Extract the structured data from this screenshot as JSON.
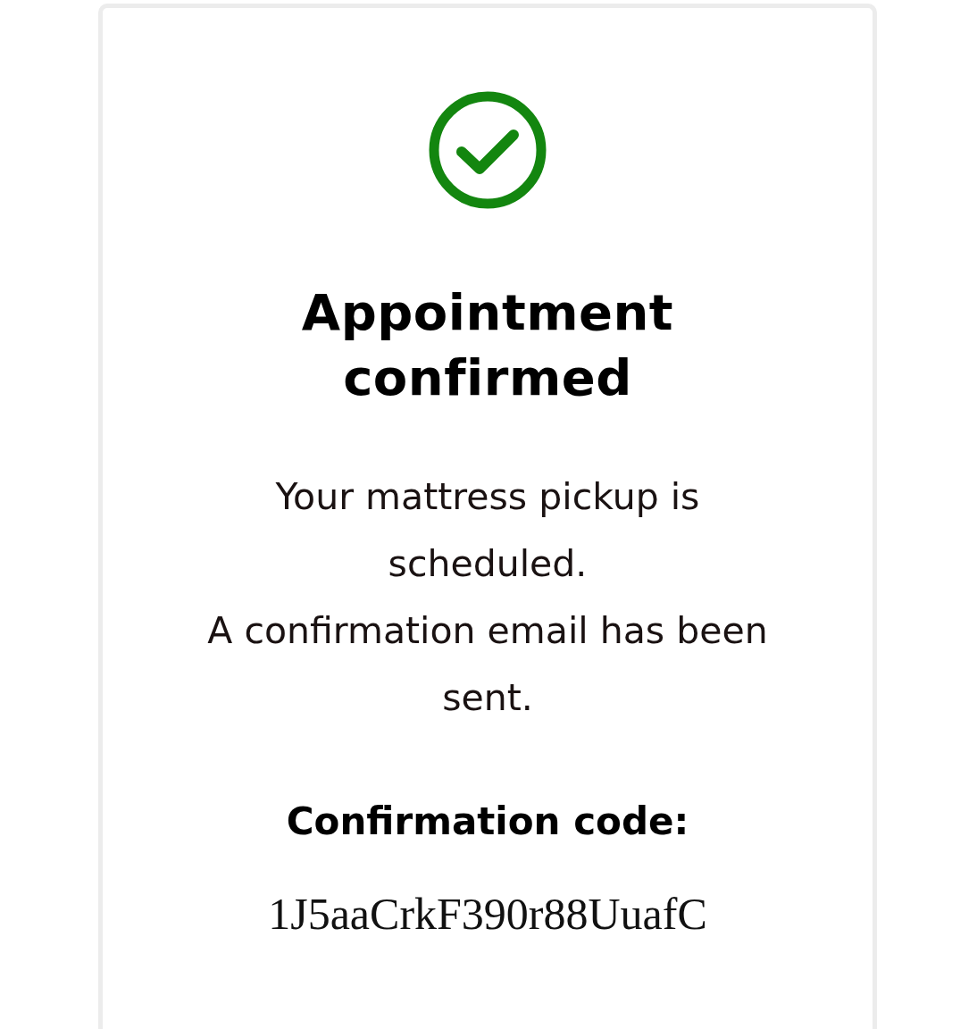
{
  "title": "Appointment confirmed",
  "messages": [
    "Your mattress pickup is scheduled.",
    "A confirmation email has been sent."
  ],
  "code_label": "Confirmation code:",
  "code": "1J5aaCrkF390r88UuafC"
}
